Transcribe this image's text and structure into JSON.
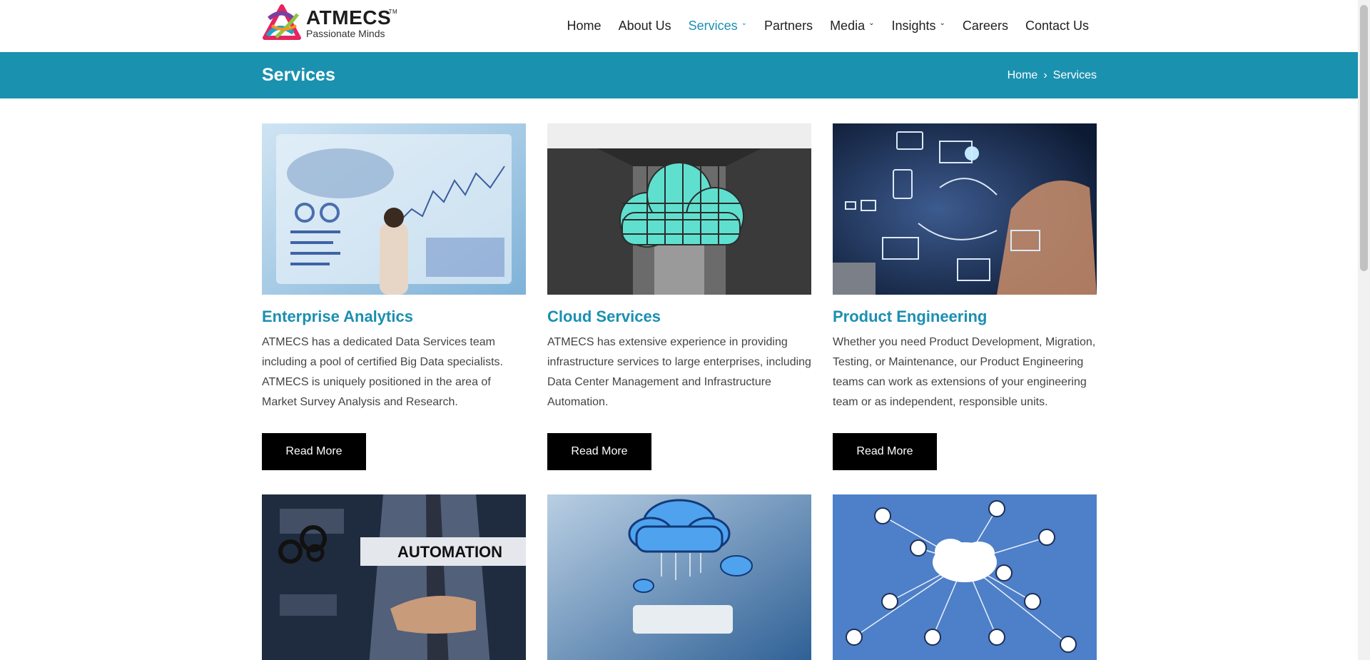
{
  "brand": {
    "name": "ATMECS",
    "trademark": "TM",
    "tagline": "Passionate Minds"
  },
  "nav": [
    {
      "label": "Home",
      "active": false,
      "dropdown": false
    },
    {
      "label": "About Us",
      "active": false,
      "dropdown": false
    },
    {
      "label": "Services",
      "active": true,
      "dropdown": true
    },
    {
      "label": "Partners",
      "active": false,
      "dropdown": false
    },
    {
      "label": "Media",
      "active": false,
      "dropdown": true
    },
    {
      "label": "Insights",
      "active": false,
      "dropdown": true
    },
    {
      "label": "Careers",
      "active": false,
      "dropdown": false
    },
    {
      "label": "Contact Us",
      "active": false,
      "dropdown": false
    }
  ],
  "page_title": "Services",
  "breadcrumb": {
    "home": "Home",
    "separator": "›",
    "current": "Services"
  },
  "cards": [
    {
      "title": "Enterprise Analytics",
      "text": "ATMECS has a dedicated Data Services team including a pool of certified Big Data specialists. ATMECS is uniquely positioned in the area of Market Survey Analysis and Research.",
      "button": "Read More"
    },
    {
      "title": "Cloud Services",
      "text": "ATMECS has extensive experience in providing infrastructure services to large enterprises, including Data Center Management and Infrastructure Automation.",
      "button": "Read More"
    },
    {
      "title": "Product Engineering",
      "text": "Whether you need Product Development, Migration, Testing, or Maintenance, our Product Engineering teams can work as extensions of your engineering team or as independent, responsible units.",
      "button": "Read More"
    }
  ],
  "automation_label": "AUTOMATION",
  "colors": {
    "accent": "#1b8fb2",
    "title_bar": "#1b91b0",
    "button": "#000000"
  }
}
